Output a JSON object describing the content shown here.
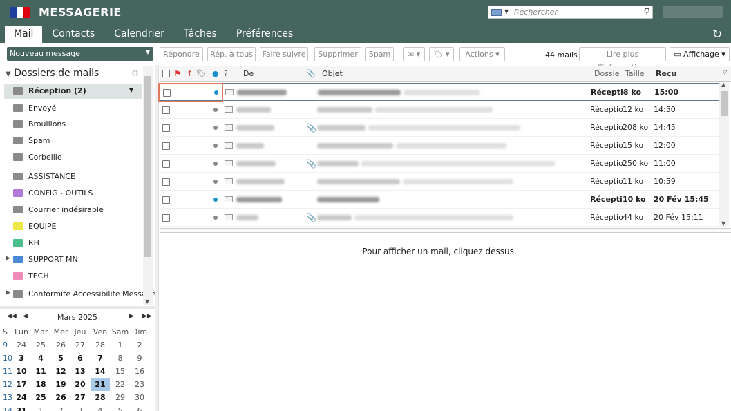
{
  "header": {
    "app_title": "MESSAGERIE",
    "search_placeholder": "Rechercher",
    "brand_colors": {
      "blue": "#1d3f9e",
      "white": "#ffffff",
      "red": "#e1000f"
    },
    "accent": "#46655f"
  },
  "tabs": [
    "Mail",
    "Contacts",
    "Calendrier",
    "Tâches",
    "Préférences"
  ],
  "sidebar": {
    "new_message": "Nouveau message",
    "folders_title": "Dossiers de mails",
    "folders": [
      {
        "label": "Réception (2)",
        "color": "#8a8a8a",
        "icon": "inbox-icon"
      },
      {
        "label": "Envoyé",
        "color": "#8a8a8a",
        "icon": "folder-icon"
      },
      {
        "label": "Brouillons",
        "color": "#8a8a8a",
        "icon": "folder-icon"
      },
      {
        "label": "Spam",
        "color": "#8a8a8a",
        "icon": "folder-icon"
      },
      {
        "label": "Corbeille",
        "color": "#8a8a8a",
        "icon": "trash-icon"
      },
      {
        "label": "ASSISTANCE",
        "color": "#8a8a8a",
        "icon": "folder-icon"
      },
      {
        "label": "CONFIG - OUTILS",
        "color": "#b07ad8",
        "icon": "folder-icon"
      },
      {
        "label": "Courrier indésirable",
        "color": "#8a8a8a",
        "icon": "folder-icon"
      },
      {
        "label": "EQUIPE",
        "color": "#f0e84a",
        "icon": "folder-icon"
      },
      {
        "label": "RH",
        "color": "#4cc08a",
        "icon": "folder-icon"
      },
      {
        "label": "SUPPORT MN",
        "color": "#4a88d8",
        "icon": "folder-icon"
      },
      {
        "label": "TECH",
        "color": "#f08ab8",
        "icon": "folder-icon"
      },
      {
        "label": "Conformite Accessibilite Messager",
        "color": "#8a8a8a",
        "icon": "shared-folder-icon"
      }
    ]
  },
  "calendar": {
    "month": "Mars 2025",
    "headers": [
      "S",
      "Lun",
      "Mar",
      "Mer",
      "Jeu",
      "Ven",
      "Sam",
      "Dim"
    ],
    "weeks": [
      {
        "wk": "9",
        "days": [
          "24",
          "25",
          "26",
          "27",
          "28",
          "1",
          "2"
        ]
      },
      {
        "wk": "10",
        "days": [
          "3",
          "4",
          "5",
          "6",
          "7",
          "8",
          "9"
        ]
      },
      {
        "wk": "11",
        "days": [
          "10",
          "11",
          "12",
          "13",
          "14",
          "15",
          "16"
        ]
      },
      {
        "wk": "12",
        "days": [
          "17",
          "18",
          "19",
          "20",
          "21",
          "22",
          "23"
        ]
      },
      {
        "wk": "13",
        "days": [
          "24",
          "25",
          "26",
          "27",
          "28",
          "29",
          "30"
        ]
      },
      {
        "wk": "14",
        "days": [
          "31",
          "1",
          "2",
          "3",
          "4",
          "5",
          "6"
        ]
      }
    ],
    "today": "21"
  },
  "toolbar": {
    "reply": "Répondre",
    "reply_all": "Rép. à tous",
    "forward": "Faire suivre",
    "delete": "Supprimer",
    "spam": "Spam",
    "actions": "Actions",
    "count": "44 mails",
    "more_info": "Lire plus d'informations",
    "display": "Affichage"
  },
  "list": {
    "headers": {
      "from": "De",
      "subject": "Objet",
      "folder": "Dossie",
      "size": "Taille",
      "received": "Reçu"
    },
    "rows": [
      {
        "folder": "Réception",
        "size": "8 ko",
        "date": "15:00",
        "unread": true,
        "attach": false
      },
      {
        "folder": "Réception",
        "size": "12 ko",
        "date": "14:50",
        "unread": false,
        "attach": false
      },
      {
        "folder": "Réception",
        "size": "208 ko",
        "date": "14:45",
        "unread": false,
        "attach": true
      },
      {
        "folder": "Réception",
        "size": "15 ko",
        "date": "12:00",
        "unread": false,
        "attach": false
      },
      {
        "folder": "Réception",
        "size": "250 ko",
        "date": "11:00",
        "unread": false,
        "attach": true
      },
      {
        "folder": "Réception",
        "size": "11 ko",
        "date": "10:59",
        "unread": false,
        "attach": false
      },
      {
        "folder": "Réception",
        "size": "10 ko",
        "date": "20 Fév 15:45",
        "unread": true,
        "attach": false
      },
      {
        "folder": "Réception",
        "size": "44 ko",
        "date": "20 Fév 15:11",
        "unread": false,
        "attach": true
      }
    ]
  },
  "preview": {
    "empty_text": "Pour afficher un mail, cliquez dessus."
  }
}
